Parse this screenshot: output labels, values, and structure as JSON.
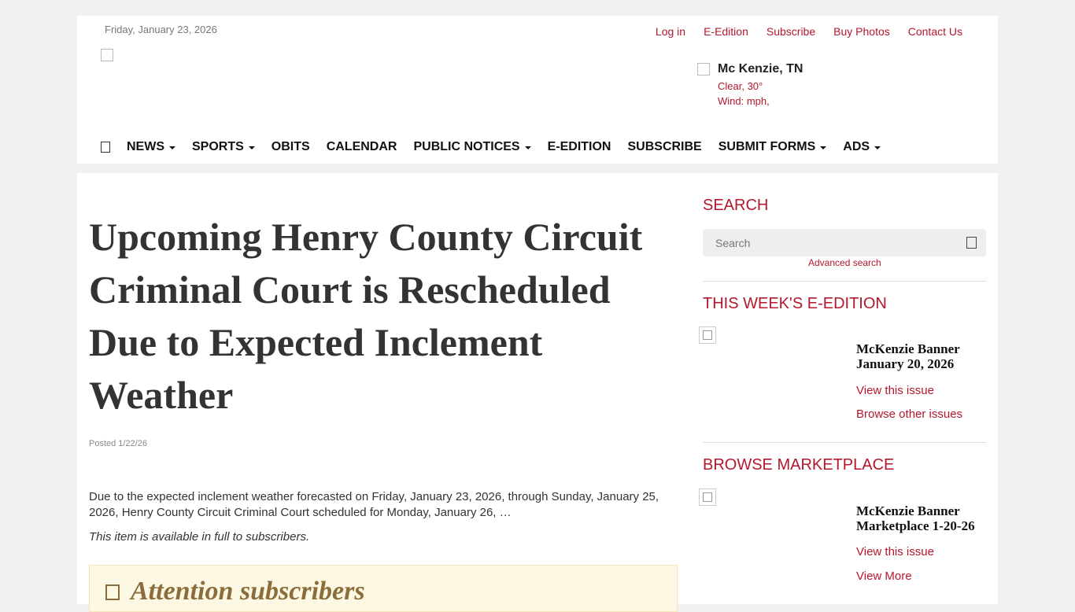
{
  "header": {
    "date": "Friday, January 23, 2026",
    "top_links": {
      "login": " Log in",
      "eedition": "E-Edition",
      "subscribe": "Subscribe",
      "buy_photos": "Buy Photos",
      "contact": "Contact Us"
    },
    "weather": {
      "location": "Mc Kenzie, TN",
      "condition": "Clear, 30°",
      "wind": "Wind: mph,"
    },
    "nav": {
      "news": "NEWS",
      "sports": "SPORTS",
      "obits": "OBITS",
      "calendar": "CALENDAR",
      "public_notices": "PUBLIC NOTICES",
      "eedition": "E-EDITION",
      "subscribe": "SUBSCRIBE",
      "submit_forms": "SUBMIT FORMS",
      "ads": "ADS"
    }
  },
  "article": {
    "headline": "Upcoming Henry County Circuit Criminal Court is Rescheduled Due to Expected Inclement Weather",
    "posted": "Posted 1/22/26",
    "body": "Due to the expected inclement weather forecasted on Friday, January 23, 2026, through Sunday, January 25, 2026, Henry County Circuit Criminal Court scheduled for Monday, January 26, …",
    "subscriber_note": "This item is available in full to subscribers.",
    "attention_title": "Attention subscribers"
  },
  "sidebar": {
    "search_heading": "SEARCH",
    "search_placeholder": "Search",
    "advanced_search": "Advanced search",
    "eedition_heading": "THIS WEEK'S E-EDITION",
    "eedition_title": "McKenzie Banner January 20, 2026",
    "view_issue": "View this issue",
    "browse_issues": "Browse other issues",
    "marketplace_heading": "BROWSE MARKETPLACE",
    "marketplace_title": "McKenzie Banner Marketplace 1-20-26",
    "view_issue_2": "View this issue",
    "view_more": "View More"
  },
  "colors": {
    "accent": "#b5172d",
    "page_background": "#f1f1f1",
    "attention_background": "#fcf8e3",
    "attention_text": "#8a6d3b"
  },
  "icons": [
    "login-icon",
    "home-icon",
    "search-icon",
    "attention-icon",
    "weather-icon"
  ]
}
